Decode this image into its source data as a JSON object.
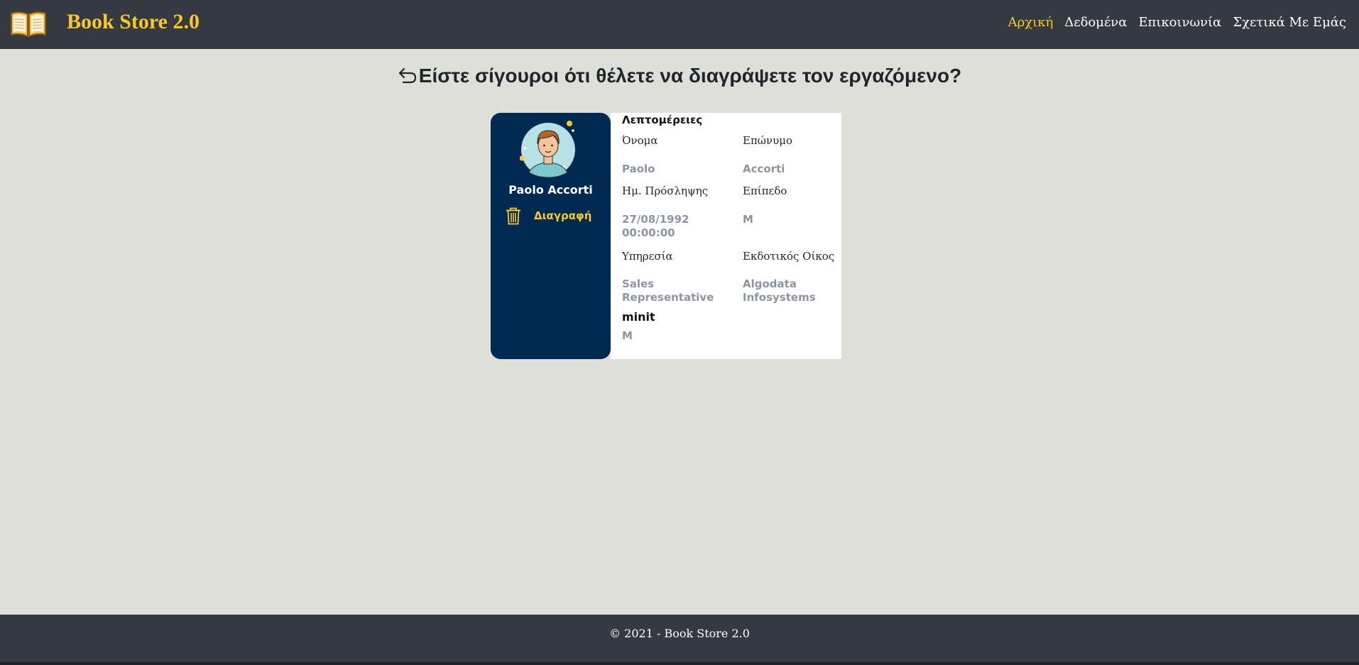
{
  "header": {
    "brand": "Book Store 2.0",
    "logo_icon": "open-book-icon",
    "nav": [
      {
        "label": "Αρχική",
        "active": true
      },
      {
        "label": "Δεδομένα",
        "active": false
      },
      {
        "label": "Επικοινωνία",
        "active": false
      },
      {
        "label": "Σχετικά Με Εμάς",
        "active": false
      }
    ]
  },
  "main": {
    "title": "Είστε σίγουροι ότι θέλετε να διαγράψετε τον εργαζόμενο?",
    "back_icon": "back-arrow-icon"
  },
  "card": {
    "name": "Paolo Accorti",
    "delete_label": "Διαγραφή",
    "details_title": "Λεπτομέρειες",
    "fields": {
      "first_name_label": "Όνομα",
      "first_name_value": "Paolo",
      "last_name_label": "Επώνυμο",
      "last_name_value": "Accorti",
      "hire_date_label": "Ημ. Πρόσληψης",
      "hire_date_value": "27/08/1992 00:00:00",
      "level_label": "Επίπεδο",
      "level_value": "M",
      "job_label": "Υπηρεσία",
      "job_value": "Sales Representative",
      "publisher_label": "Εκδοτικός Οίκος",
      "publisher_value": "Algodata Infosystems",
      "minit_label": "minit",
      "minit_value": "M"
    }
  },
  "footer": {
    "text": "© 2021 - Book Store 2.0"
  },
  "colors": {
    "navbar": "#343a40",
    "accent": "#f7c830",
    "card_dark": "#012a52",
    "background": "#dfdfda"
  }
}
